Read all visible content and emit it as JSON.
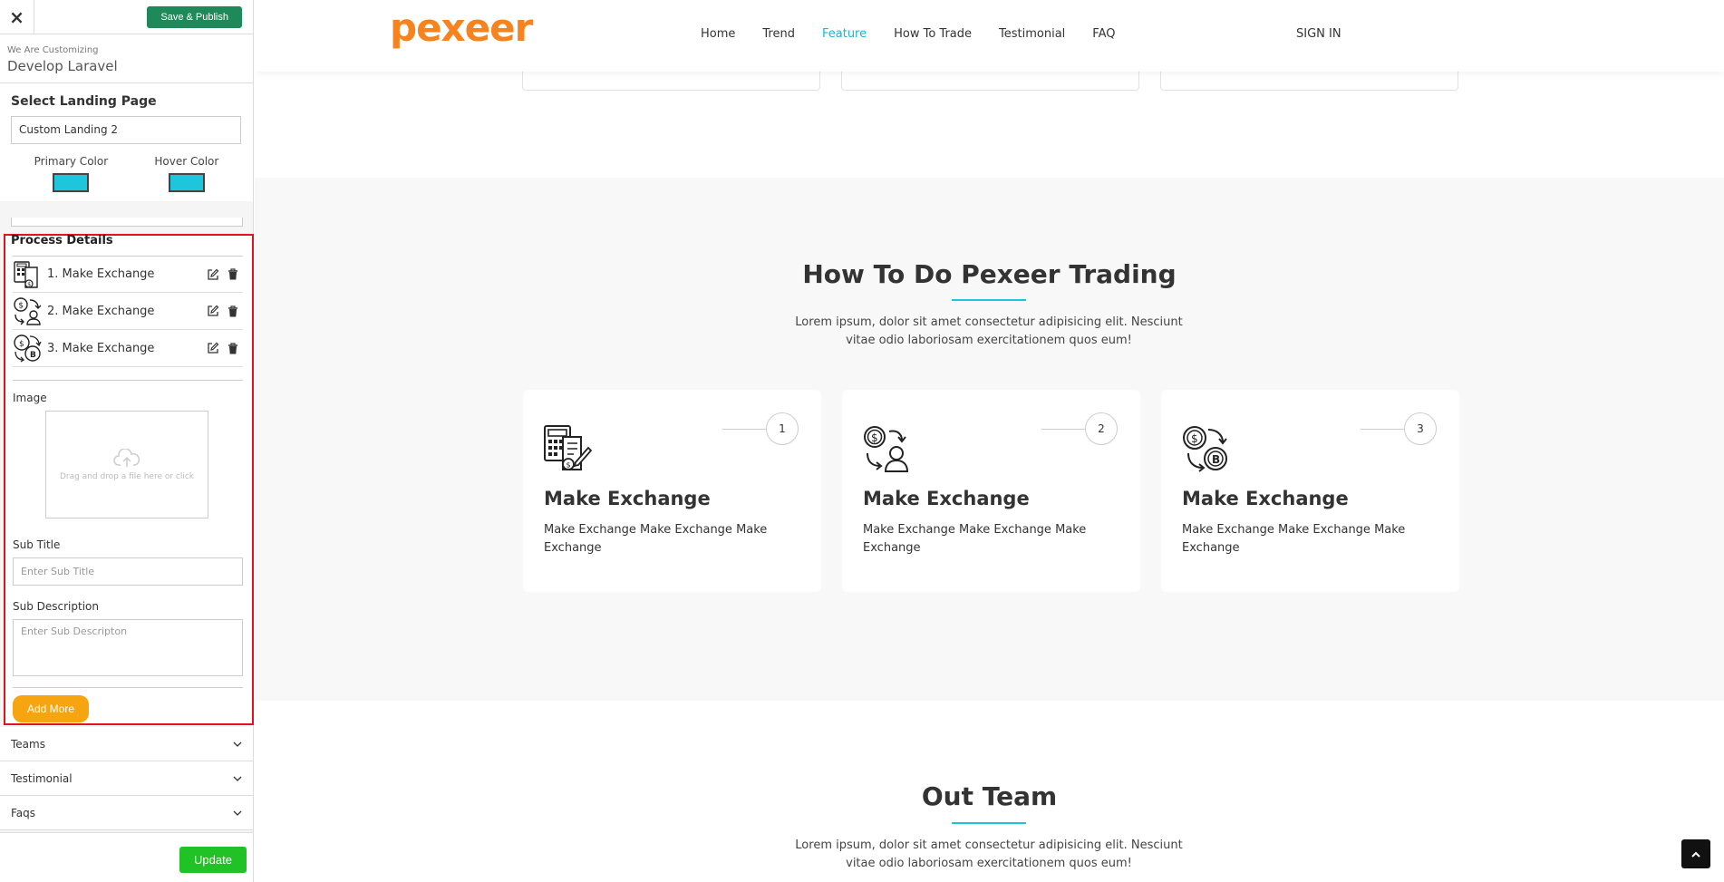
{
  "sidebar": {
    "close_label": "×",
    "publish_label": "Save & Publish",
    "customizing_label": "We Are Customizing",
    "site_name": "Develop Laravel",
    "landing_label": "Select Landing Page",
    "landing_value": "Custom Landing 2",
    "primary_color_label": "Primary Color",
    "primary_color": "#1ec6dc",
    "hover_color_label": "Hover Color",
    "hover_color": "#1ec6dc",
    "process": {
      "title": "Process Details",
      "items": [
        {
          "label": "1. Make Exchange",
          "icon": "calculator-document-icon"
        },
        {
          "label": "2. Make Exchange",
          "icon": "coin-exchange-user-icon"
        },
        {
          "label": "3. Make Exchange",
          "icon": "dollar-bitcoin-exchange-icon"
        }
      ],
      "image_label": "Image",
      "dropzone_text": "Drag and drop a file here or click",
      "subtitle_label": "Sub Title",
      "subtitle_placeholder": "Enter Sub Title",
      "subdesc_label": "Sub Description",
      "subdesc_placeholder": "Enter Sub Descripton",
      "add_more_label": "Add More"
    },
    "accordion": [
      "Teams",
      "Testimonial",
      "Faqs"
    ],
    "update_label": "Update"
  },
  "site": {
    "logo": "pexeer",
    "nav": [
      "Home",
      "Trend",
      "Feature",
      "How To Trade",
      "Testimonial",
      "FAQ"
    ],
    "nav_active": "Feature",
    "signin": "SIGN IN",
    "howto": {
      "title": "How To Do Pexeer Trading",
      "desc": "Lorem ipsum, dolor sit amet consectetur adipisicing elit. Nesciunt vitae odio laboriosam exercitationem quos eum!",
      "steps": [
        {
          "num": "1",
          "title": "Make Exchange",
          "desc": "Make Exchange Make Exchange Make Exchange"
        },
        {
          "num": "2",
          "title": "Make Exchange",
          "desc": "Make Exchange Make Exchange Make Exchange"
        },
        {
          "num": "3",
          "title": "Make Exchange",
          "desc": "Make Exchange Make Exchange Make Exchange"
        }
      ]
    },
    "team": {
      "title": "Out Team",
      "desc": "Lorem ipsum, dolor sit amet consectetur adipisicing elit. Nesciunt vitae odio laboriosam exercitationem quos eum!"
    }
  }
}
